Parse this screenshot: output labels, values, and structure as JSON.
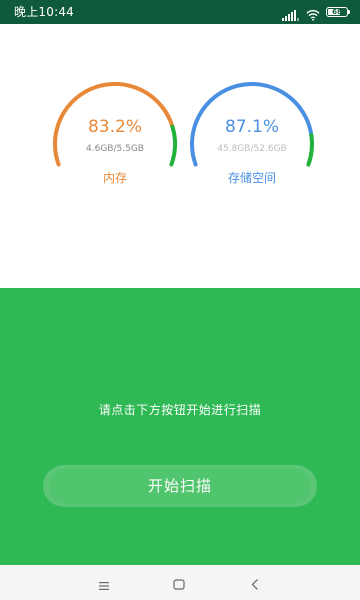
{
  "status_bar": {
    "time": "晚上10:44",
    "battery_level": 0.68,
    "battery_text": "68"
  },
  "gauges": {
    "memory": {
      "percent": "83.2%",
      "usage": "4.6GB/5.5GB",
      "label": "内存",
      "level": 0.832,
      "color": "#e8893a",
      "highlight_color": "#22b13a"
    },
    "storage": {
      "percent": "87.1%",
      "usage": "45.8GB/52.6GB",
      "label": "存储空间",
      "level": 0.871,
      "color": "#4a90e2",
      "highlight_color": "#22b13a"
    }
  },
  "scan": {
    "hint": "请点击下方按钮开始进行扫描",
    "button_label": "开始扫描",
    "panel_color": "#2fb955"
  },
  "nav": {
    "icons": [
      "menu-icon",
      "home-icon",
      "back-icon"
    ]
  }
}
